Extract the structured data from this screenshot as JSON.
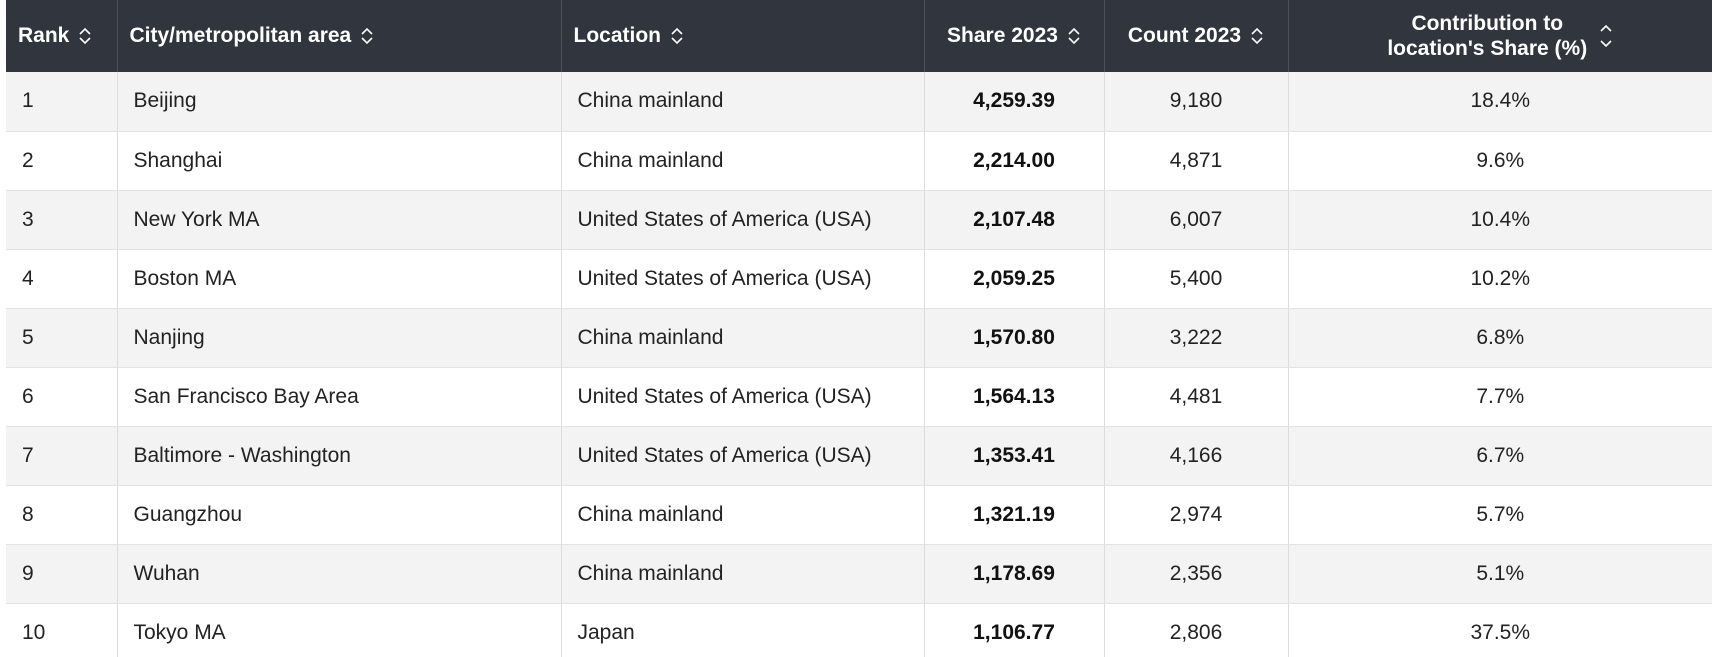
{
  "table": {
    "headers": {
      "rank": "Rank",
      "city": "City/metropolitan area",
      "location": "Location",
      "share": "Share 2023",
      "count": "Count 2023",
      "contrib_line1": "Contribution to",
      "contrib_line2": "location's Share (%)"
    },
    "rows": [
      {
        "rank": "1",
        "city": "Beijing",
        "location": "China mainland",
        "share": "4,259.39",
        "count": "9,180",
        "contribution": "18.4%"
      },
      {
        "rank": "2",
        "city": "Shanghai",
        "location": "China mainland",
        "share": "2,214.00",
        "count": "4,871",
        "contribution": "9.6%"
      },
      {
        "rank": "3",
        "city": "New York MA",
        "location": "United States of America (USA)",
        "share": "2,107.48",
        "count": "6,007",
        "contribution": "10.4%"
      },
      {
        "rank": "4",
        "city": "Boston MA",
        "location": "United States of America (USA)",
        "share": "2,059.25",
        "count": "5,400",
        "contribution": "10.2%"
      },
      {
        "rank": "5",
        "city": "Nanjing",
        "location": "China mainland",
        "share": "1,570.80",
        "count": "3,222",
        "contribution": "6.8%"
      },
      {
        "rank": "6",
        "city": "San Francisco Bay Area",
        "location": "United States of America (USA)",
        "share": "1,564.13",
        "count": "4,481",
        "contribution": "7.7%"
      },
      {
        "rank": "7",
        "city": "Baltimore - Washington",
        "location": "United States of America (USA)",
        "share": "1,353.41",
        "count": "4,166",
        "contribution": "6.7%"
      },
      {
        "rank": "8",
        "city": "Guangzhou",
        "location": "China mainland",
        "share": "1,321.19",
        "count": "2,974",
        "contribution": "5.7%"
      },
      {
        "rank": "9",
        "city": "Wuhan",
        "location": "China mainland",
        "share": "1,178.69",
        "count": "2,356",
        "contribution": "5.1%"
      },
      {
        "rank": "10",
        "city": "Tokyo MA",
        "location": "Japan",
        "share": "1,106.77",
        "count": "2,806",
        "contribution": "37.5%"
      }
    ]
  },
  "icons": {
    "sort_default": "sort-up-down-icon",
    "sort_split": "sort-up-down-split-icon"
  },
  "colors": {
    "header_bg": "#31353d",
    "header_text": "#ffffff",
    "row_alt_bg": "#f3f3f3"
  }
}
